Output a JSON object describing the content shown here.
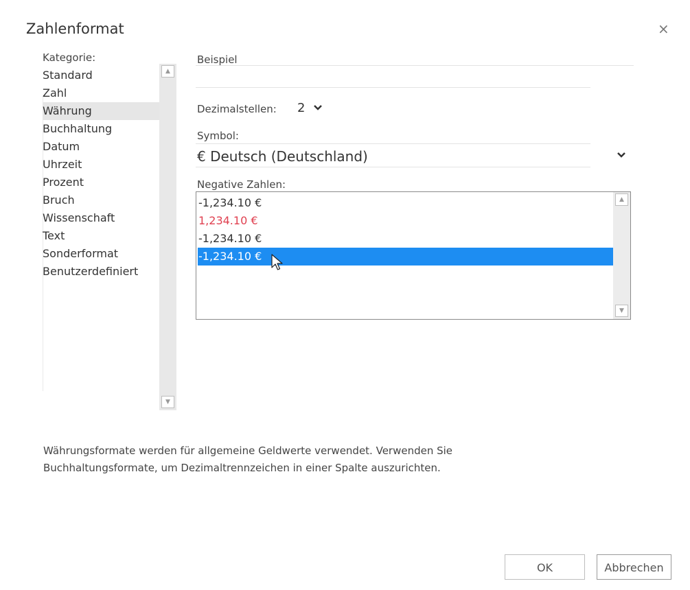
{
  "dialog": {
    "title": "Zahlenformat",
    "close_glyph": "×"
  },
  "category": {
    "label": "Kategorie:",
    "items": [
      "Standard",
      "Zahl",
      "Währung",
      "Buchhaltung",
      "Datum",
      "Uhrzeit",
      "Prozent",
      "Bruch",
      "Wissenschaft",
      "Text",
      "Sonderformat",
      "Benutzerdefiniert"
    ],
    "selected": "Währung"
  },
  "example": {
    "label": "Beispiel",
    "value": ""
  },
  "decimals": {
    "label": "Dezimalstellen:",
    "value": "2"
  },
  "symbol": {
    "label": "Symbol:",
    "value": "€ Deutsch (Deutschland)"
  },
  "negative": {
    "label": "Negative Zahlen:",
    "options": [
      "-1,234.10 €",
      "1,234.10 €",
      "-1,234.10 €",
      "-1,234.10 €"
    ],
    "selected_index": 3,
    "red_color": "#e04050",
    "selection_color": "#1d8df2"
  },
  "description": [
    "Währungsformate werden für allgemeine Geldwerte verwendet. Verwenden Sie",
    "Buchhaltungsformate, um Dezimaltrennzeichen in einer Spalte auszurichten."
  ],
  "buttons": {
    "ok": "OK",
    "cancel": "Abbrechen"
  },
  "icons": {
    "close": "close-icon",
    "chevron": "chevron-down-icon",
    "scroll_up": "arrow-up-icon",
    "scroll_down": "arrow-down-icon",
    "pointer": "mouse-cursor"
  }
}
